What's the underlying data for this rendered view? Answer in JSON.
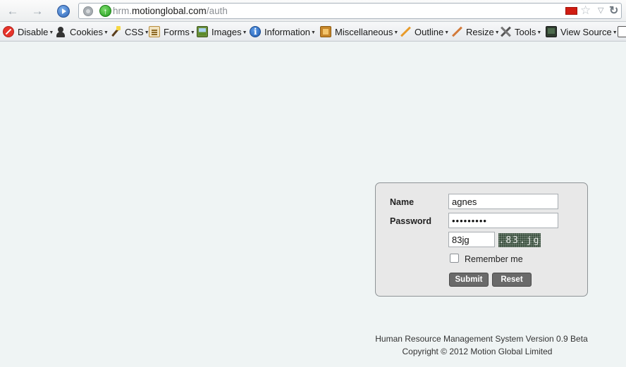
{
  "browser": {
    "url_prefix": "hrm.",
    "url_host": "motionglobal.com",
    "url_path": "/auth",
    "icons": {
      "back": "back-arrow-icon",
      "forward": "forward-arrow-icon",
      "home": "home-icon",
      "site": "globe-icon",
      "secure": "secure-connection-icon",
      "flag": "flag-icon",
      "bookmark": "star-icon",
      "dropdown": "dropdown-arrow-icon",
      "reload": "reload-icon"
    }
  },
  "toolbar": {
    "items": [
      {
        "label": "Disable",
        "icon": "disable-icon"
      },
      {
        "label": "Cookies",
        "icon": "cookies-icon"
      },
      {
        "label": "CSS",
        "icon": "css-icon"
      },
      {
        "label": "Forms",
        "icon": "forms-icon"
      },
      {
        "label": "Images",
        "icon": "images-icon"
      },
      {
        "label": "Information",
        "icon": "information-icon"
      },
      {
        "label": "Miscellaneous",
        "icon": "miscellaneous-icon"
      },
      {
        "label": "Outline",
        "icon": "outline-icon"
      },
      {
        "label": "Resize",
        "icon": "resize-icon"
      },
      {
        "label": "Tools",
        "icon": "tools-icon"
      },
      {
        "label": "View Source",
        "icon": "view-source-icon"
      }
    ]
  },
  "login": {
    "name_label": "Name",
    "name_value": "agnes",
    "password_label": "Password",
    "password_value": "•••••••••",
    "captcha_value": "83jg",
    "captcha_image_text": ".83.jg",
    "remember_label": "Remember me",
    "remember_checked": false,
    "submit_label": "Submit",
    "reset_label": "Reset"
  },
  "footer": {
    "line1": "Human Resource Management System Version 0.9 Beta",
    "line2": "Copyright © 2012 Motion Global Limited"
  },
  "colors": {
    "page_background": "#eff4f4",
    "panel_background": "#e8e8e8",
    "button_background": "#6a6a6a"
  }
}
